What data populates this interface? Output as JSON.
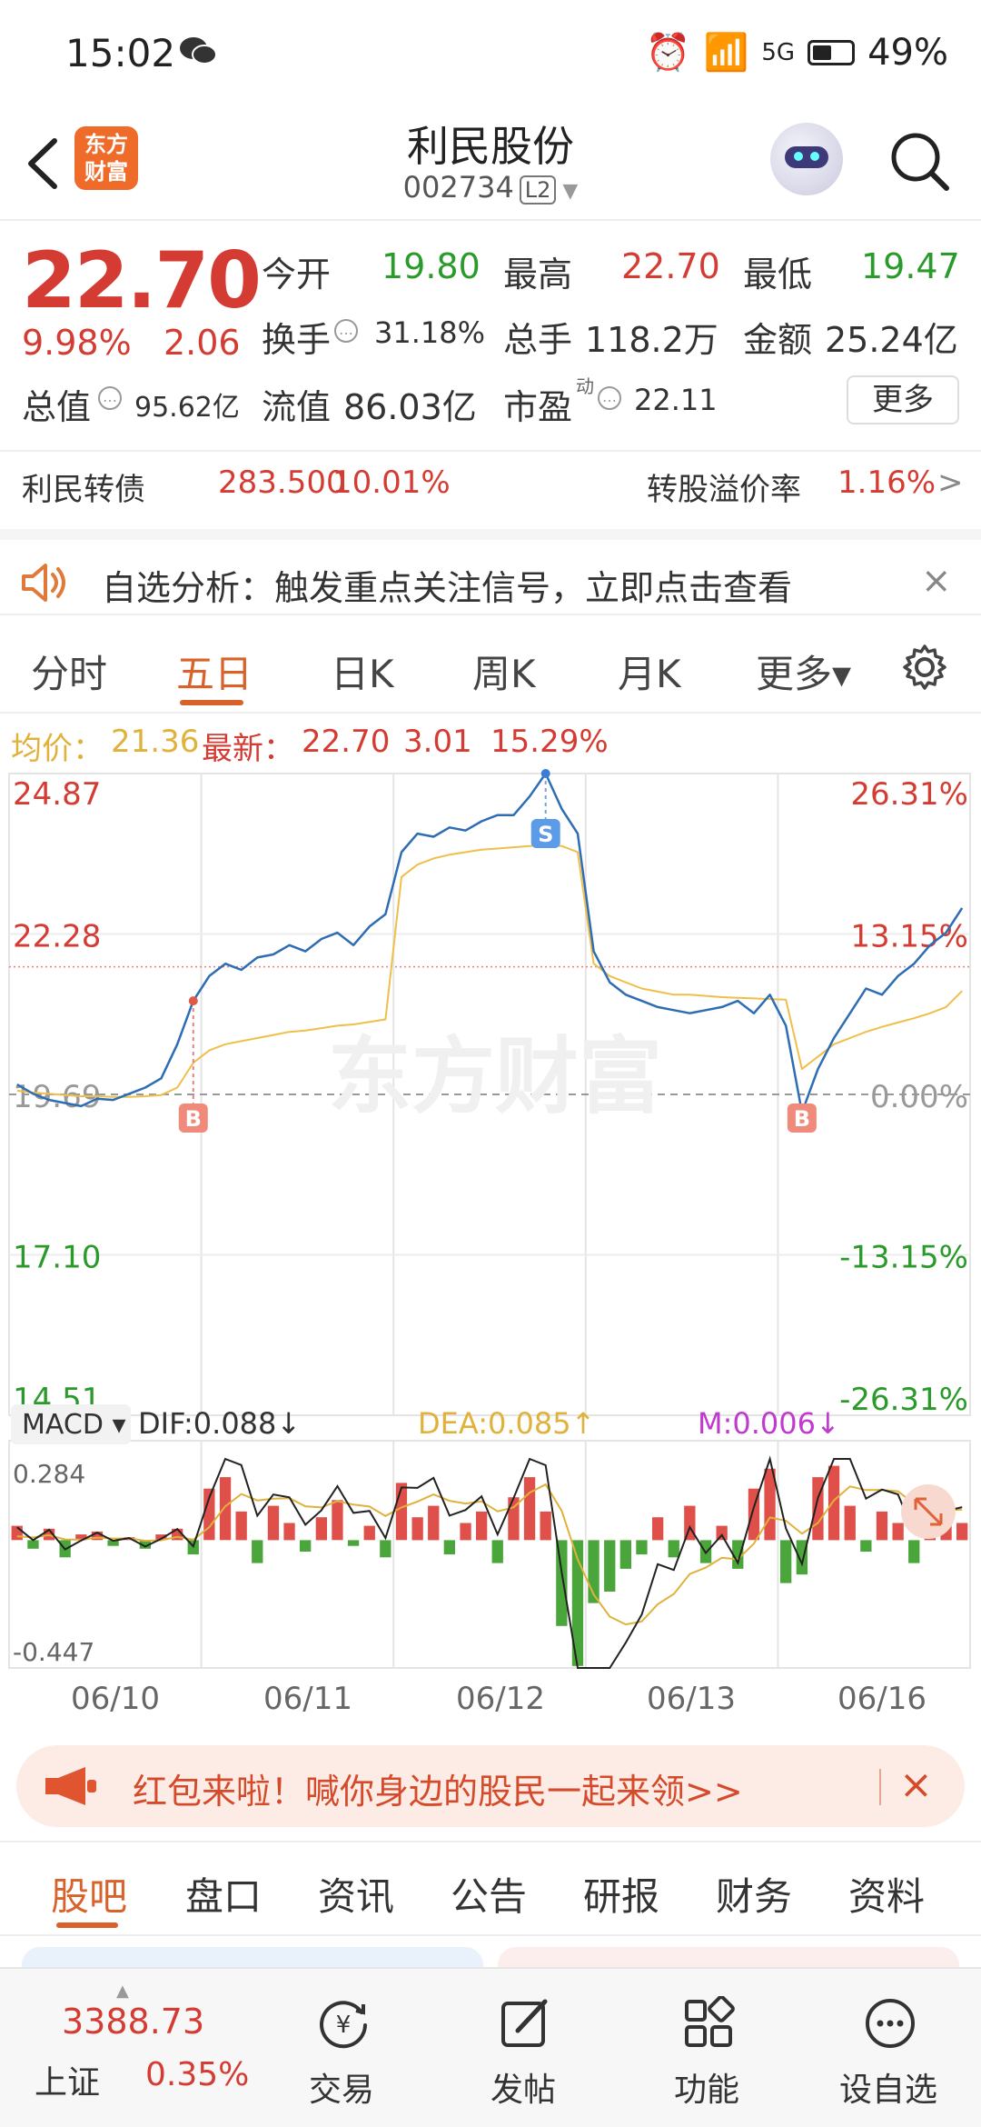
{
  "status": {
    "time": "15:02",
    "network": "5G",
    "battery": "49%"
  },
  "header": {
    "app_logo": "东方财富",
    "stock_name": "利民股份",
    "stock_code": "002734",
    "level": "L2"
  },
  "quote": {
    "price": "22.70",
    "change_pct": "9.98%",
    "change": "2.06",
    "open_label": "今开",
    "open": "19.80",
    "high_label": "最高",
    "high": "22.70",
    "low_label": "最低",
    "low": "19.47",
    "turnover_label": "换手",
    "turnover": "31.18%",
    "volume_label": "总手",
    "volume": "118.2万",
    "amount_label": "金额",
    "amount": "25.24亿",
    "mktcap_label": "总值",
    "mktcap": "95.62亿",
    "float_label": "流值",
    "float": "86.03亿",
    "pe_label": "市盈",
    "pe_sup": "动",
    "pe": "22.11",
    "more": "更多"
  },
  "bond": {
    "name": "利民转债",
    "price": "283.500",
    "pct": "10.01%",
    "premium_label": "转股溢价率",
    "premium": "1.16%",
    "arrow": ">"
  },
  "notice": {
    "text": "自选分析：触发重点关注信号，立即点击查看",
    "close": "×"
  },
  "chart_tabs": [
    "分时",
    "五日",
    "日K",
    "周K",
    "月K",
    "更多▾"
  ],
  "avg": {
    "label": "均价：",
    "value": "21.36",
    "latest_label": "最新：",
    "latest": "22.70",
    "chg": "3.01",
    "pct": "15.29%"
  },
  "chart_data": {
    "type": "line",
    "x": [
      "06/10",
      "06/11",
      "06/12",
      "06/13",
      "06/16"
    ],
    "y_left_ticks": [
      "24.87",
      "22.28",
      "19.69",
      "17.10",
      "14.51"
    ],
    "y_right_ticks": [
      "26.31%",
      "13.15%",
      "0.00%",
      "-13.15%",
      "-26.31%"
    ],
    "ylim": [
      14.51,
      24.87
    ],
    "prev_close": 19.69,
    "watermark": "东方财富",
    "series": [
      {
        "name": "price",
        "color": "#2e6db3",
        "values": [
          19.85,
          19.7,
          19.6,
          19.55,
          19.5,
          19.62,
          19.6,
          19.7,
          19.8,
          19.95,
          20.5,
          21.2,
          21.6,
          21.8,
          21.7,
          21.9,
          21.95,
          22.1,
          22.0,
          22.2,
          22.3,
          22.1,
          22.4,
          22.6,
          23.6,
          23.9,
          23.85,
          24.0,
          23.95,
          24.1,
          24.2,
          24.2,
          24.5,
          24.87,
          24.3,
          23.9,
          22.0,
          21.5,
          21.3,
          21.2,
          21.1,
          21.05,
          21.0,
          21.05,
          21.1,
          21.2,
          21.0,
          21.3,
          20.8,
          19.4,
          20.1,
          20.6,
          21.0,
          21.4,
          21.3,
          21.6,
          21.8,
          22.1,
          22.3,
          22.7
        ]
      },
      {
        "name": "avg",
        "color": "#efbf4a",
        "values": [
          19.75,
          19.72,
          19.7,
          19.68,
          19.66,
          19.66,
          19.65,
          19.65,
          19.66,
          19.68,
          19.8,
          20.2,
          20.4,
          20.5,
          20.55,
          20.6,
          20.65,
          20.7,
          20.72,
          20.76,
          20.8,
          20.82,
          20.86,
          20.9,
          23.2,
          23.4,
          23.5,
          23.56,
          23.6,
          23.64,
          23.66,
          23.68,
          23.7,
          23.72,
          23.7,
          23.6,
          21.8,
          21.6,
          21.5,
          21.4,
          21.35,
          21.3,
          21.3,
          21.28,
          21.26,
          21.25,
          21.24,
          21.23,
          21.22,
          20.1,
          20.3,
          20.5,
          20.6,
          20.7,
          20.78,
          20.85,
          20.92,
          21.0,
          21.1,
          21.36
        ]
      }
    ],
    "markers": [
      {
        "label": "B",
        "x_index": 11,
        "type": "buy"
      },
      {
        "label": "S",
        "x_index": 33,
        "type": "sell"
      },
      {
        "label": "B",
        "x_index": 49,
        "type": "buy"
      }
    ],
    "macd": {
      "selector": "MACD ▾",
      "dif_label": "DIF:0.088↓",
      "dea_label": "DEA:0.085↑",
      "m_label": "M:0.006↓",
      "ylim": [
        -0.447,
        0.284
      ],
      "top_tick": "0.284",
      "bottom_tick": "-0.447",
      "bars": [
        0.05,
        -0.03,
        0.04,
        -0.06,
        0.02,
        0.03,
        -0.02,
        0.01,
        -0.03,
        0.02,
        0.04,
        -0.05,
        0.18,
        0.22,
        0.1,
        -0.08,
        0.12,
        0.06,
        -0.04,
        0.08,
        0.14,
        -0.02,
        0.05,
        -0.06,
        0.2,
        0.08,
        0.12,
        -0.05,
        0.06,
        0.1,
        -0.08,
        0.15,
        0.22,
        0.1,
        -0.3,
        -0.44,
        -0.22,
        -0.18,
        -0.1,
        -0.05,
        0.08,
        -0.06,
        0.12,
        -0.08,
        0.05,
        -0.1,
        0.18,
        0.25,
        -0.15,
        -0.12,
        0.22,
        0.26,
        0.12,
        -0.04,
        0.1,
        0.06,
        -0.08,
        0.04,
        0.08,
        0.06
      ]
    }
  },
  "dates": [
    "06/10",
    "06/11",
    "06/12",
    "06/13",
    "06/16"
  ],
  "banner": {
    "text": "红包来啦！喊你身边的股民一起来领>>",
    "close": "×"
  },
  "bottom_tabs": [
    "股吧",
    "盘口",
    "资讯",
    "公告",
    "研报",
    "财务",
    "资料"
  ],
  "nav": {
    "index_value": "3388.73",
    "index_name": "上证",
    "index_pct": "0.35%",
    "items": [
      "交易",
      "发帖",
      "功能",
      "设自选"
    ]
  },
  "colors": {
    "up": "#d43c33",
    "down": "#2a9a2a",
    "accent": "#d9622b"
  }
}
